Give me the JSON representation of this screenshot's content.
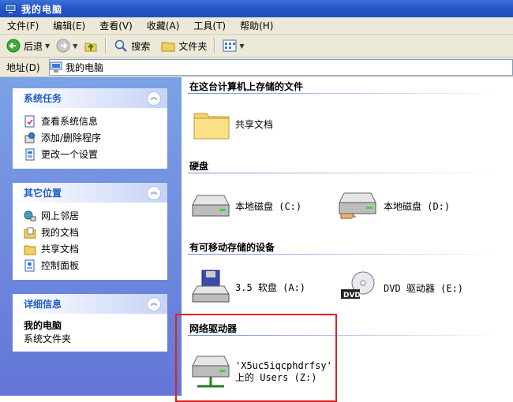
{
  "window": {
    "title": "我的电脑",
    "title_icon": "computer-icon"
  },
  "menu": [
    "文件(F)",
    "编辑(E)",
    "查看(V)",
    "收藏(A)",
    "工具(T)",
    "帮助(H)"
  ],
  "toolbar": {
    "back": "后退",
    "search": "搜索",
    "folders": "文件夹"
  },
  "address": {
    "label": "地址(D)",
    "value": "我的电脑"
  },
  "system_tasks": {
    "title": "系统任务",
    "items": [
      "查看系统信息",
      "添加/删除程序",
      "更改一个设置"
    ]
  },
  "other_places": {
    "title": "其它位置",
    "items": [
      "网上邻居",
      "我的文档",
      "共享文档",
      "控制面板"
    ]
  },
  "details": {
    "title": "详细信息",
    "name": "我的电脑",
    "desc": "系统文件夹"
  },
  "groups": {
    "stored": {
      "title": "在这台计算机上存储的文件",
      "items": [
        "共享文档"
      ]
    },
    "hard_disks": {
      "title": "硬盘",
      "items": [
        "本地磁盘 (C:)",
        "本地磁盘 (D:)"
      ]
    },
    "removable": {
      "title": "有可移动存储的设备",
      "items": [
        "3.5 软盘 (A:)",
        "DVD 驱动器 (E:)"
      ]
    },
    "network": {
      "title": "网络驱动器",
      "line1": "'X5uc5iqcphdrfsy'",
      "line2": "上的 Users (Z:)"
    }
  },
  "colors": {
    "titlebar": "#2456c6",
    "panel": "#6f8fd6",
    "highlight_border": "#e02020"
  }
}
